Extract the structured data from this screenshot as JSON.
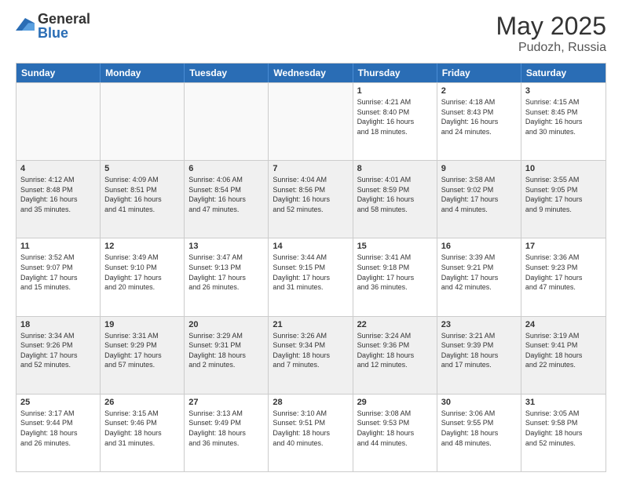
{
  "logo": {
    "general": "General",
    "blue": "Blue"
  },
  "header": {
    "month": "May 2025",
    "location": "Pudozh, Russia"
  },
  "days_of_week": [
    "Sunday",
    "Monday",
    "Tuesday",
    "Wednesday",
    "Thursday",
    "Friday",
    "Saturday"
  ],
  "rows": [
    [
      {
        "day": "",
        "text": "",
        "empty": true
      },
      {
        "day": "",
        "text": "",
        "empty": true
      },
      {
        "day": "",
        "text": "",
        "empty": true
      },
      {
        "day": "",
        "text": "",
        "empty": true
      },
      {
        "day": "1",
        "text": "Sunrise: 4:21 AM\nSunset: 8:40 PM\nDaylight: 16 hours\nand 18 minutes.",
        "empty": false
      },
      {
        "day": "2",
        "text": "Sunrise: 4:18 AM\nSunset: 8:43 PM\nDaylight: 16 hours\nand 24 minutes.",
        "empty": false
      },
      {
        "day": "3",
        "text": "Sunrise: 4:15 AM\nSunset: 8:45 PM\nDaylight: 16 hours\nand 30 minutes.",
        "empty": false
      }
    ],
    [
      {
        "day": "4",
        "text": "Sunrise: 4:12 AM\nSunset: 8:48 PM\nDaylight: 16 hours\nand 35 minutes.",
        "empty": false
      },
      {
        "day": "5",
        "text": "Sunrise: 4:09 AM\nSunset: 8:51 PM\nDaylight: 16 hours\nand 41 minutes.",
        "empty": false
      },
      {
        "day": "6",
        "text": "Sunrise: 4:06 AM\nSunset: 8:54 PM\nDaylight: 16 hours\nand 47 minutes.",
        "empty": false
      },
      {
        "day": "7",
        "text": "Sunrise: 4:04 AM\nSunset: 8:56 PM\nDaylight: 16 hours\nand 52 minutes.",
        "empty": false
      },
      {
        "day": "8",
        "text": "Sunrise: 4:01 AM\nSunset: 8:59 PM\nDaylight: 16 hours\nand 58 minutes.",
        "empty": false
      },
      {
        "day": "9",
        "text": "Sunrise: 3:58 AM\nSunset: 9:02 PM\nDaylight: 17 hours\nand 4 minutes.",
        "empty": false
      },
      {
        "day": "10",
        "text": "Sunrise: 3:55 AM\nSunset: 9:05 PM\nDaylight: 17 hours\nand 9 minutes.",
        "empty": false
      }
    ],
    [
      {
        "day": "11",
        "text": "Sunrise: 3:52 AM\nSunset: 9:07 PM\nDaylight: 17 hours\nand 15 minutes.",
        "empty": false
      },
      {
        "day": "12",
        "text": "Sunrise: 3:49 AM\nSunset: 9:10 PM\nDaylight: 17 hours\nand 20 minutes.",
        "empty": false
      },
      {
        "day": "13",
        "text": "Sunrise: 3:47 AM\nSunset: 9:13 PM\nDaylight: 17 hours\nand 26 minutes.",
        "empty": false
      },
      {
        "day": "14",
        "text": "Sunrise: 3:44 AM\nSunset: 9:15 PM\nDaylight: 17 hours\nand 31 minutes.",
        "empty": false
      },
      {
        "day": "15",
        "text": "Sunrise: 3:41 AM\nSunset: 9:18 PM\nDaylight: 17 hours\nand 36 minutes.",
        "empty": false
      },
      {
        "day": "16",
        "text": "Sunrise: 3:39 AM\nSunset: 9:21 PM\nDaylight: 17 hours\nand 42 minutes.",
        "empty": false
      },
      {
        "day": "17",
        "text": "Sunrise: 3:36 AM\nSunset: 9:23 PM\nDaylight: 17 hours\nand 47 minutes.",
        "empty": false
      }
    ],
    [
      {
        "day": "18",
        "text": "Sunrise: 3:34 AM\nSunset: 9:26 PM\nDaylight: 17 hours\nand 52 minutes.",
        "empty": false
      },
      {
        "day": "19",
        "text": "Sunrise: 3:31 AM\nSunset: 9:29 PM\nDaylight: 17 hours\nand 57 minutes.",
        "empty": false
      },
      {
        "day": "20",
        "text": "Sunrise: 3:29 AM\nSunset: 9:31 PM\nDaylight: 18 hours\nand 2 minutes.",
        "empty": false
      },
      {
        "day": "21",
        "text": "Sunrise: 3:26 AM\nSunset: 9:34 PM\nDaylight: 18 hours\nand 7 minutes.",
        "empty": false
      },
      {
        "day": "22",
        "text": "Sunrise: 3:24 AM\nSunset: 9:36 PM\nDaylight: 18 hours\nand 12 minutes.",
        "empty": false
      },
      {
        "day": "23",
        "text": "Sunrise: 3:21 AM\nSunset: 9:39 PM\nDaylight: 18 hours\nand 17 minutes.",
        "empty": false
      },
      {
        "day": "24",
        "text": "Sunrise: 3:19 AM\nSunset: 9:41 PM\nDaylight: 18 hours\nand 22 minutes.",
        "empty": false
      }
    ],
    [
      {
        "day": "25",
        "text": "Sunrise: 3:17 AM\nSunset: 9:44 PM\nDaylight: 18 hours\nand 26 minutes.",
        "empty": false
      },
      {
        "day": "26",
        "text": "Sunrise: 3:15 AM\nSunset: 9:46 PM\nDaylight: 18 hours\nand 31 minutes.",
        "empty": false
      },
      {
        "day": "27",
        "text": "Sunrise: 3:13 AM\nSunset: 9:49 PM\nDaylight: 18 hours\nand 36 minutes.",
        "empty": false
      },
      {
        "day": "28",
        "text": "Sunrise: 3:10 AM\nSunset: 9:51 PM\nDaylight: 18 hours\nand 40 minutes.",
        "empty": false
      },
      {
        "day": "29",
        "text": "Sunrise: 3:08 AM\nSunset: 9:53 PM\nDaylight: 18 hours\nand 44 minutes.",
        "empty": false
      },
      {
        "day": "30",
        "text": "Sunrise: 3:06 AM\nSunset: 9:55 PM\nDaylight: 18 hours\nand 48 minutes.",
        "empty": false
      },
      {
        "day": "31",
        "text": "Sunrise: 3:05 AM\nSunset: 9:58 PM\nDaylight: 18 hours\nand 52 minutes.",
        "empty": false
      }
    ]
  ]
}
